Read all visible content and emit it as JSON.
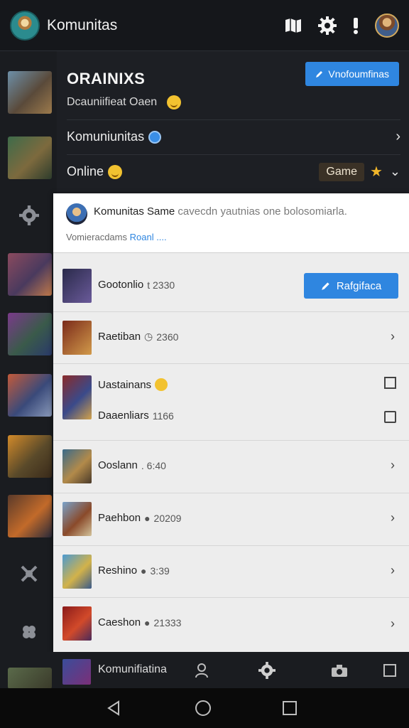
{
  "app": {
    "title": "Komunitas",
    "icons": [
      "map-icon",
      "gear-icon",
      "alert-icon",
      "avatar"
    ]
  },
  "colors": {
    "accent": "#2f86e0",
    "top_bar": "#15171b",
    "panel": "#ededed",
    "star": "#f1b62a"
  },
  "header": {
    "title": "ORAINIXS",
    "button_label": "Vnofoumfinas",
    "subtitle": "Dcauniifieat Oaen",
    "rows": [
      {
        "label": "Komuniunitas"
      },
      {
        "label": "Online",
        "chip": "Game"
      }
    ]
  },
  "popup": {
    "title": "Komunitas Same",
    "text": "cavecdn  yautnias one bolosomiarla.",
    "sub": "Vomieracdams",
    "link": "Roanl ...."
  },
  "list": [
    {
      "title": "Gootonlio",
      "meta": "t 2330",
      "button": "Rafgifaca"
    },
    {
      "title": "Raetiban",
      "meta": "2360"
    },
    {
      "title": "Uastainans",
      "sub_title": "Daaenliars",
      "sub_meta": "1166"
    },
    {
      "title": "Ooslann",
      "meta": ". 6:40"
    },
    {
      "title": "Paehbon",
      "meta": "20209"
    },
    {
      "title": "Reshino",
      "meta": "3:39"
    },
    {
      "title": "Caeshon",
      "meta": "21333"
    }
  ],
  "tabbar": {
    "label": "Komunifiatina",
    "icons": [
      "person-icon",
      "gear-icon",
      "camera-icon",
      "square-icon"
    ]
  },
  "navbar": {
    "icons": [
      "back-icon",
      "home-icon",
      "recents-icon"
    ]
  }
}
